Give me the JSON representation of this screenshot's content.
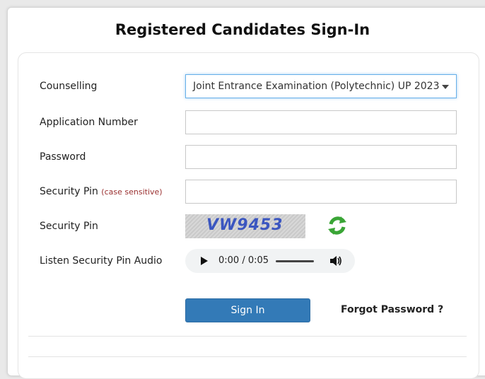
{
  "page": {
    "title": "Registered Candidates Sign-In"
  },
  "form": {
    "counselling": {
      "label": "Counselling",
      "selected": "Joint Entrance Examination (Polytechnic) UP 2023"
    },
    "application_number": {
      "label": "Application Number",
      "value": ""
    },
    "password": {
      "label": "Password",
      "value": ""
    },
    "security_pin_input": {
      "label": "Security Pin",
      "hint": "(case sensitive)",
      "value": ""
    },
    "security_pin_image": {
      "label": "Security Pin",
      "captcha_text": "VW9453",
      "refresh_icon": "refresh-icon"
    },
    "audio": {
      "label": "Listen Security Pin Audio",
      "time": "0:00 / 0:05",
      "play_icon": "play-icon",
      "volume_icon": "volume-icon"
    },
    "sign_in_label": "Sign In",
    "forgot_password_label": "Forgot Password ?"
  },
  "colors": {
    "primary_button": "#337ab7",
    "focus_border": "#66afe9",
    "hint_text": "#9a3030"
  }
}
